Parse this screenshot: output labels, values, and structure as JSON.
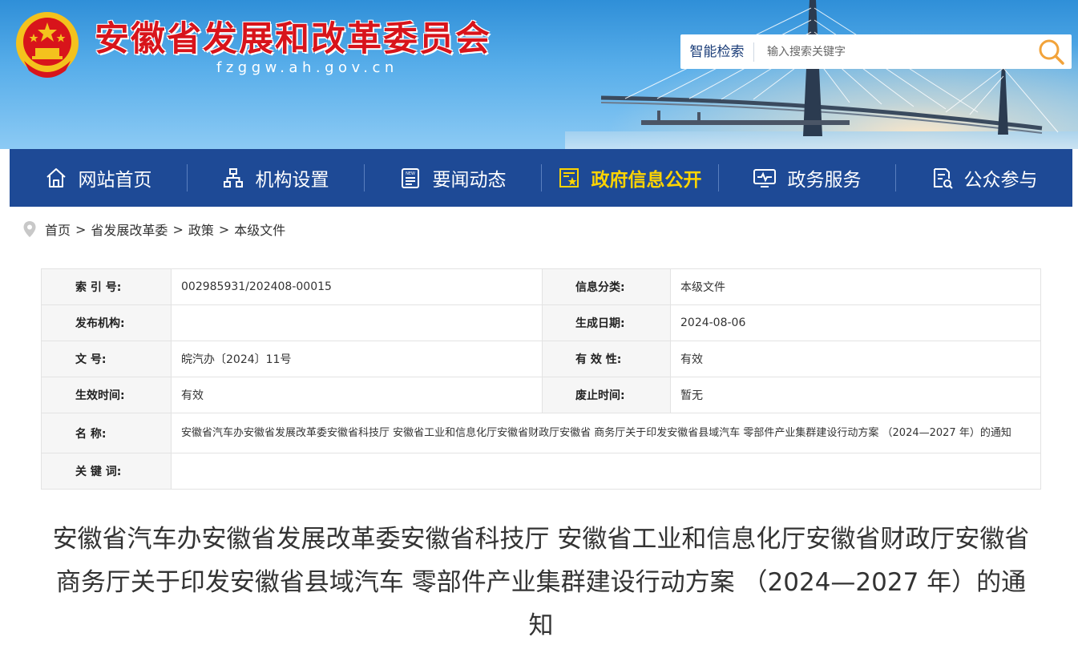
{
  "header": {
    "site_title": "安徽省发展和改革委员会",
    "site_domain": "fzggw.ah.gov.cn",
    "emblem_icon": "national-emblem-icon",
    "search": {
      "label": "智能检索",
      "placeholder": "输入搜索关键字",
      "button_icon": "search-icon"
    }
  },
  "colors": {
    "title_red": "#d8141b",
    "nav_blue": "#1e4a96",
    "nav_active": "#ffd400",
    "search_accent": "#f2a33a"
  },
  "nav": {
    "items": [
      {
        "label": "网站首页",
        "icon": "home-icon"
      },
      {
        "label": "机构设置",
        "icon": "org-chart-icon"
      },
      {
        "label": "要闻动态",
        "icon": "news-icon"
      },
      {
        "label": "政府信息公开",
        "icon": "document-star-icon"
      },
      {
        "label": "政务服务",
        "icon": "monitor-icon"
      },
      {
        "label": "公众参与",
        "icon": "feedback-icon"
      }
    ],
    "active_label": "政府信息公开"
  },
  "breadcrumb": {
    "icon": "location-pin-icon",
    "items": [
      "首页",
      "省发展改革委",
      "政策",
      "本级文件"
    ],
    "separator": ">"
  },
  "info_table": {
    "index_no_label": "索 引 号:",
    "index_no": "002985931/202408-00015",
    "category_label": "信息分类:",
    "category": "本级文件",
    "publisher_label": "发布机构:",
    "publisher": "",
    "created_date_label": "生成日期:",
    "created_date": "2024-08-06",
    "doc_no_label": "文 号:",
    "doc_no": "皖汽办〔2024〕11号",
    "validity_label": "有 效 性:",
    "validity": "有效",
    "effective_label": "生效时间:",
    "effective": "有效",
    "repeal_label": "废止时间:",
    "repeal": "暂无",
    "name_label": "名 称:",
    "name": "安徽省汽车办安徽省发展改革委安徽省科技厅 安徽省工业和信息化厅安徽省财政厅安徽省 商务厅关于印发安徽省县域汽车 零部件产业集群建设行动方案 （2024—2027 年）的通知",
    "keywords_label": "关 键 词:",
    "keywords": ""
  },
  "article": {
    "title": "安徽省汽车办安徽省发展改革委安徽省科技厅 安徽省工业和信息化厅安徽省财政厅安徽省 商务厅关于印发安徽省县域汽车 零部件产业集群建设行动方案 （2024—2027 年）的通知"
  }
}
